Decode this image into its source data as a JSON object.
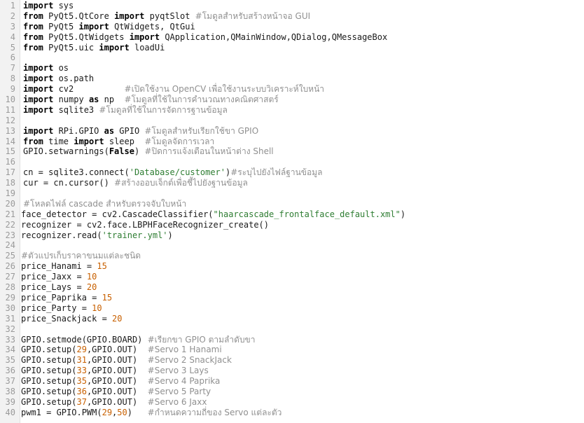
{
  "editor": {
    "lines": [
      {
        "n": "1",
        "tokens": [
          {
            "t": "import",
            "k": "kw"
          },
          {
            "t": " sys",
            "k": "plain"
          }
        ]
      },
      {
        "n": "2",
        "tokens": [
          {
            "t": "from",
            "k": "kw"
          },
          {
            "t": " PyQt5.QtCore ",
            "k": "plain"
          },
          {
            "t": "import",
            "k": "kw"
          },
          {
            "t": " pyqtSlot ",
            "k": "plain"
          },
          {
            "t": "#โมดูลสำหรับสร้างหน้าจอ GUI",
            "k": "cmt"
          }
        ]
      },
      {
        "n": "3",
        "tokens": [
          {
            "t": "from",
            "k": "kw"
          },
          {
            "t": " PyQt5 ",
            "k": "plain"
          },
          {
            "t": "import",
            "k": "kw"
          },
          {
            "t": " QtWidgets, QtGui",
            "k": "plain"
          }
        ]
      },
      {
        "n": "4",
        "tokens": [
          {
            "t": "from",
            "k": "kw"
          },
          {
            "t": " PyQt5.QtWidgets ",
            "k": "plain"
          },
          {
            "t": "import",
            "k": "kw"
          },
          {
            "t": " QApplication,QMainWindow,QDialog,QMessageBox",
            "k": "plain"
          }
        ]
      },
      {
        "n": "5",
        "tokens": [
          {
            "t": "from",
            "k": "kw"
          },
          {
            "t": " PyQt5.uic ",
            "k": "plain"
          },
          {
            "t": "import",
            "k": "kw"
          },
          {
            "t": " loadUi",
            "k": "plain"
          }
        ]
      },
      {
        "n": "6",
        "tokens": []
      },
      {
        "n": "7",
        "tokens": [
          {
            "t": "import",
            "k": "kw"
          },
          {
            "t": " os",
            "k": "plain"
          }
        ]
      },
      {
        "n": "8",
        "tokens": [
          {
            "t": "import",
            "k": "kw"
          },
          {
            "t": " os.path",
            "k": "plain"
          }
        ]
      },
      {
        "n": "9",
        "tokens": [
          {
            "t": "import",
            "k": "kw"
          },
          {
            "t": " cv2          ",
            "k": "plain"
          },
          {
            "t": "#เปิดใช้งาน OpenCV เพื่อใช้งานระบบวิเคราะห์ใบหน้า",
            "k": "cmt"
          }
        ]
      },
      {
        "n": "10",
        "tokens": [
          {
            "t": "import",
            "k": "kw"
          },
          {
            "t": " numpy ",
            "k": "plain"
          },
          {
            "t": "as",
            "k": "kw"
          },
          {
            "t": " np  ",
            "k": "plain"
          },
          {
            "t": "#โมดูลที่ใช้ในการคำนวณทางคณิตศาสตร์",
            "k": "cmt"
          }
        ]
      },
      {
        "n": "11",
        "tokens": [
          {
            "t": "import",
            "k": "kw"
          },
          {
            "t": " sqlite3 ",
            "k": "plain"
          },
          {
            "t": "#โมดูลที่ใช้ในการจัดการฐานข้อมูล",
            "k": "cmt"
          }
        ]
      },
      {
        "n": "12",
        "tokens": []
      },
      {
        "n": "13",
        "tokens": [
          {
            "t": "import",
            "k": "kw"
          },
          {
            "t": " RPi.GPIO ",
            "k": "plain"
          },
          {
            "t": "as",
            "k": "kw"
          },
          {
            "t": " GPIO ",
            "k": "plain"
          },
          {
            "t": "#โมดูลสำหรับเรียกใช้ขา GPIO",
            "k": "cmt"
          }
        ]
      },
      {
        "n": "14",
        "tokens": [
          {
            "t": "from",
            "k": "kw"
          },
          {
            "t": " time ",
            "k": "plain"
          },
          {
            "t": "import",
            "k": "kw"
          },
          {
            "t": " sleep  ",
            "k": "plain"
          },
          {
            "t": "#โมดูลจัดการเวลา",
            "k": "cmt"
          }
        ]
      },
      {
        "n": "15",
        "tokens": [
          {
            "t": "GPIO.setwarnings(",
            "k": "plain"
          },
          {
            "t": "False",
            "k": "kw"
          },
          {
            "t": ") ",
            "k": "plain"
          },
          {
            "t": "#ปิดการแจ้งเตือนในหน้าต่าง Shell",
            "k": "cmt"
          }
        ]
      },
      {
        "n": "16",
        "tokens": []
      },
      {
        "n": "17",
        "tokens": [
          {
            "t": "cn = sqlite3.connect(",
            "k": "plain"
          },
          {
            "t": "'Database/customer'",
            "k": "str"
          },
          {
            "t": ")",
            "k": "plain"
          },
          {
            "t": "#ระบุไปยังไฟล์ฐานข้อมูล",
            "k": "cmt"
          }
        ]
      },
      {
        "n": "18",
        "tokens": [
          {
            "t": "cur = cn.cursor() ",
            "k": "plain"
          },
          {
            "t": "#สร้างออบเจ็กต์เพื่อชี้ไปยังฐานข้อมูล",
            "k": "cmt"
          }
        ]
      },
      {
        "n": "19",
        "tokens": []
      },
      {
        "n": "20",
        "tokens": [
          {
            "t": "#โหลดไฟล์ cascade สำหรับตรวจจับใบหน้า",
            "k": "cmt"
          }
        ]
      },
      {
        "n": "21",
        "shift": true,
        "tokens": [
          {
            "t": "face_detector = cv2.CascadeClassifier(",
            "k": "plain"
          },
          {
            "t": "\"haarcascade_frontalface_default.xml\"",
            "k": "str"
          },
          {
            "t": ")",
            "k": "plain"
          }
        ]
      },
      {
        "n": "22",
        "shift": true,
        "tokens": [
          {
            "t": "recognizer = cv2.face.LBPHFaceRecognizer_create()",
            "k": "plain"
          }
        ]
      },
      {
        "n": "23",
        "shift": true,
        "tokens": [
          {
            "t": "recognizer.read(",
            "k": "plain"
          },
          {
            "t": "'trainer.yml'",
            "k": "str"
          },
          {
            "t": ")",
            "k": "plain"
          }
        ]
      },
      {
        "n": "24",
        "shift": true,
        "tokens": []
      },
      {
        "n": "25",
        "shift": true,
        "tokens": [
          {
            "t": "#ตัวแปรเก็บราคาขนมแต่ละชนิด",
            "k": "cmt"
          }
        ]
      },
      {
        "n": "26",
        "shift": true,
        "tokens": [
          {
            "t": "price_Hanami = ",
            "k": "plain"
          },
          {
            "t": "15",
            "k": "num"
          }
        ]
      },
      {
        "n": "27",
        "shift": true,
        "tokens": [
          {
            "t": "price_Jaxx = ",
            "k": "plain"
          },
          {
            "t": "10",
            "k": "num"
          }
        ]
      },
      {
        "n": "28",
        "shift": true,
        "tokens": [
          {
            "t": "price_Lays = ",
            "k": "plain"
          },
          {
            "t": "20",
            "k": "num"
          }
        ]
      },
      {
        "n": "29",
        "shift": true,
        "tokens": [
          {
            "t": "price_Paprika = ",
            "k": "plain"
          },
          {
            "t": "15",
            "k": "num"
          }
        ]
      },
      {
        "n": "30",
        "shift": true,
        "tokens": [
          {
            "t": "price_Party = ",
            "k": "plain"
          },
          {
            "t": "10",
            "k": "num"
          }
        ]
      },
      {
        "n": "31",
        "shift": true,
        "tokens": [
          {
            "t": "price_Snackjack = ",
            "k": "plain"
          },
          {
            "t": "20",
            "k": "num"
          }
        ]
      },
      {
        "n": "32",
        "shift": true,
        "tokens": []
      },
      {
        "n": "33",
        "shift": true,
        "tokens": [
          {
            "t": "GPIO.setmode(GPIO.BOARD) ",
            "k": "plain"
          },
          {
            "t": "#เรียกขา GPIO ตามลำดับขา",
            "k": "cmt"
          }
        ]
      },
      {
        "n": "34",
        "shift": true,
        "tokens": [
          {
            "t": "GPIO.setup(",
            "k": "plain"
          },
          {
            "t": "29",
            "k": "num"
          },
          {
            "t": ",GPIO.OUT)  ",
            "k": "plain"
          },
          {
            "t": "#Servo 1 Hanami",
            "k": "cmt"
          }
        ]
      },
      {
        "n": "35",
        "shift": true,
        "tokens": [
          {
            "t": "GPIO.setup(",
            "k": "plain"
          },
          {
            "t": "31",
            "k": "num"
          },
          {
            "t": ",GPIO.OUT)  ",
            "k": "plain"
          },
          {
            "t": "#Servo 2 SnackJack",
            "k": "cmt"
          }
        ]
      },
      {
        "n": "36",
        "shift": true,
        "tokens": [
          {
            "t": "GPIO.setup(",
            "k": "plain"
          },
          {
            "t": "33",
            "k": "num"
          },
          {
            "t": ",GPIO.OUT)  ",
            "k": "plain"
          },
          {
            "t": "#Servo 3 Lays",
            "k": "cmt"
          }
        ]
      },
      {
        "n": "37",
        "shift": true,
        "tokens": [
          {
            "t": "GPIO.setup(",
            "k": "plain"
          },
          {
            "t": "35",
            "k": "num"
          },
          {
            "t": ",GPIO.OUT)  ",
            "k": "plain"
          },
          {
            "t": "#Servo 4 Paprika",
            "k": "cmt"
          }
        ]
      },
      {
        "n": "38",
        "shift": true,
        "tokens": [
          {
            "t": "GPIO.setup(",
            "k": "plain"
          },
          {
            "t": "36",
            "k": "num"
          },
          {
            "t": ",GPIO.OUT)  ",
            "k": "plain"
          },
          {
            "t": "#Servo 5 Party",
            "k": "cmt"
          }
        ]
      },
      {
        "n": "39",
        "shift": true,
        "tokens": [
          {
            "t": "GPIO.setup(",
            "k": "plain"
          },
          {
            "t": "37",
            "k": "num"
          },
          {
            "t": ",GPIO.OUT)  ",
            "k": "plain"
          },
          {
            "t": "#Servo 6 Jaxx",
            "k": "cmt"
          }
        ]
      },
      {
        "n": "40",
        "shift": true,
        "tokens": [
          {
            "t": "pwm1 = GPIO.PWM(",
            "k": "plain"
          },
          {
            "t": "29",
            "k": "num"
          },
          {
            "t": ",",
            "k": "plain"
          },
          {
            "t": "50",
            "k": "num"
          },
          {
            "t": ")   ",
            "k": "plain"
          },
          {
            "t": "#กำหนดความถี่ของ Servo แต่ละตัว",
            "k": "cmt"
          }
        ]
      }
    ]
  }
}
